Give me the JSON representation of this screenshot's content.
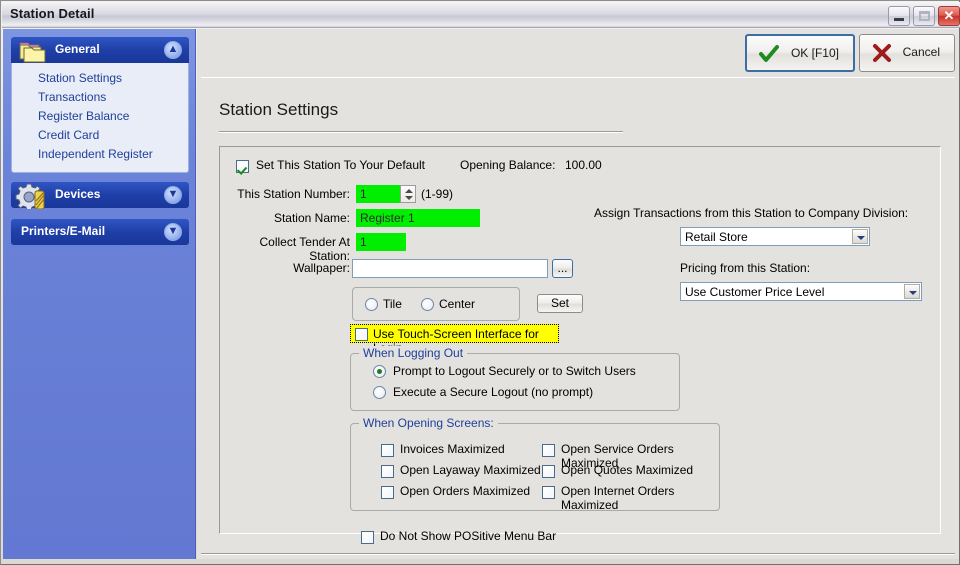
{
  "window": {
    "title": "Station Detail",
    "controls": {
      "minimize": "–",
      "maximize": "□",
      "close": "✕"
    }
  },
  "toolbar": {
    "ok_label": "OK [F10]",
    "cancel_label": "Cancel"
  },
  "sidebar": {
    "groups": [
      {
        "label": "General",
        "icon": "folders-icon",
        "expanded": true,
        "chevron": "▲",
        "items": [
          "Station Settings",
          "Transactions",
          "Register Balance",
          "Credit Card",
          "Independent Register"
        ]
      },
      {
        "label": "Devices",
        "icon": "gear-icon",
        "expanded": false,
        "chevron": "▼",
        "items": []
      },
      {
        "label": "Printers/E-Mail",
        "icon": "none",
        "expanded": false,
        "chevron": "▼",
        "items": []
      }
    ]
  },
  "page": {
    "title": "Station Settings",
    "default_station": {
      "label": "Set This Station To Your Default",
      "checked": true
    },
    "opening_balance": {
      "label": "Opening Balance:",
      "value": "100.00"
    },
    "station_number": {
      "label": "This Station Number:",
      "value": "1",
      "range_hint": "(1-99)"
    },
    "station_name": {
      "label": "Station Name:",
      "value": "Register 1"
    },
    "collect_tender": {
      "label": "Collect Tender At Station:",
      "value": "1"
    },
    "wallpaper": {
      "label": "Wallpaper:",
      "value": "",
      "browse_label": "...",
      "set_label": "Set",
      "modes": [
        {
          "label": "Tile",
          "selected": false
        },
        {
          "label": "Center",
          "selected": false
        }
      ]
    },
    "touch_screen": {
      "label": "Use Touch-Screen Interface for Login",
      "checked": false,
      "highlight_color": "#ffff00"
    },
    "division": {
      "label": "Assign Transactions from this Station to Company Division:",
      "value": "Retail Store"
    },
    "pricing": {
      "label": "Pricing from this Station:",
      "value": "Use Customer Price Level"
    },
    "logging_out": {
      "caption": "When Logging Out",
      "options": [
        {
          "label": "Prompt to Logout Securely or to Switch Users",
          "selected": true
        },
        {
          "label": "Execute a Secure Logout (no prompt)",
          "selected": false
        }
      ]
    },
    "opening_screens": {
      "caption": "When Opening Screens:",
      "left_column": [
        {
          "label": "Invoices Maximized",
          "checked": false
        },
        {
          "label": "Open Layaway Maximized",
          "checked": false
        },
        {
          "label": "Open Orders Maximized",
          "checked": false
        }
      ],
      "right_column": [
        {
          "label": "Open Service Orders Maximized",
          "checked": false
        },
        {
          "label": "Open Quotes Maximized",
          "checked": false
        },
        {
          "label": "Open Internet Orders Maximized",
          "checked": false
        }
      ]
    },
    "menu_bar": {
      "label": "Do Not Show POSitive Menu Bar",
      "checked": false
    }
  }
}
